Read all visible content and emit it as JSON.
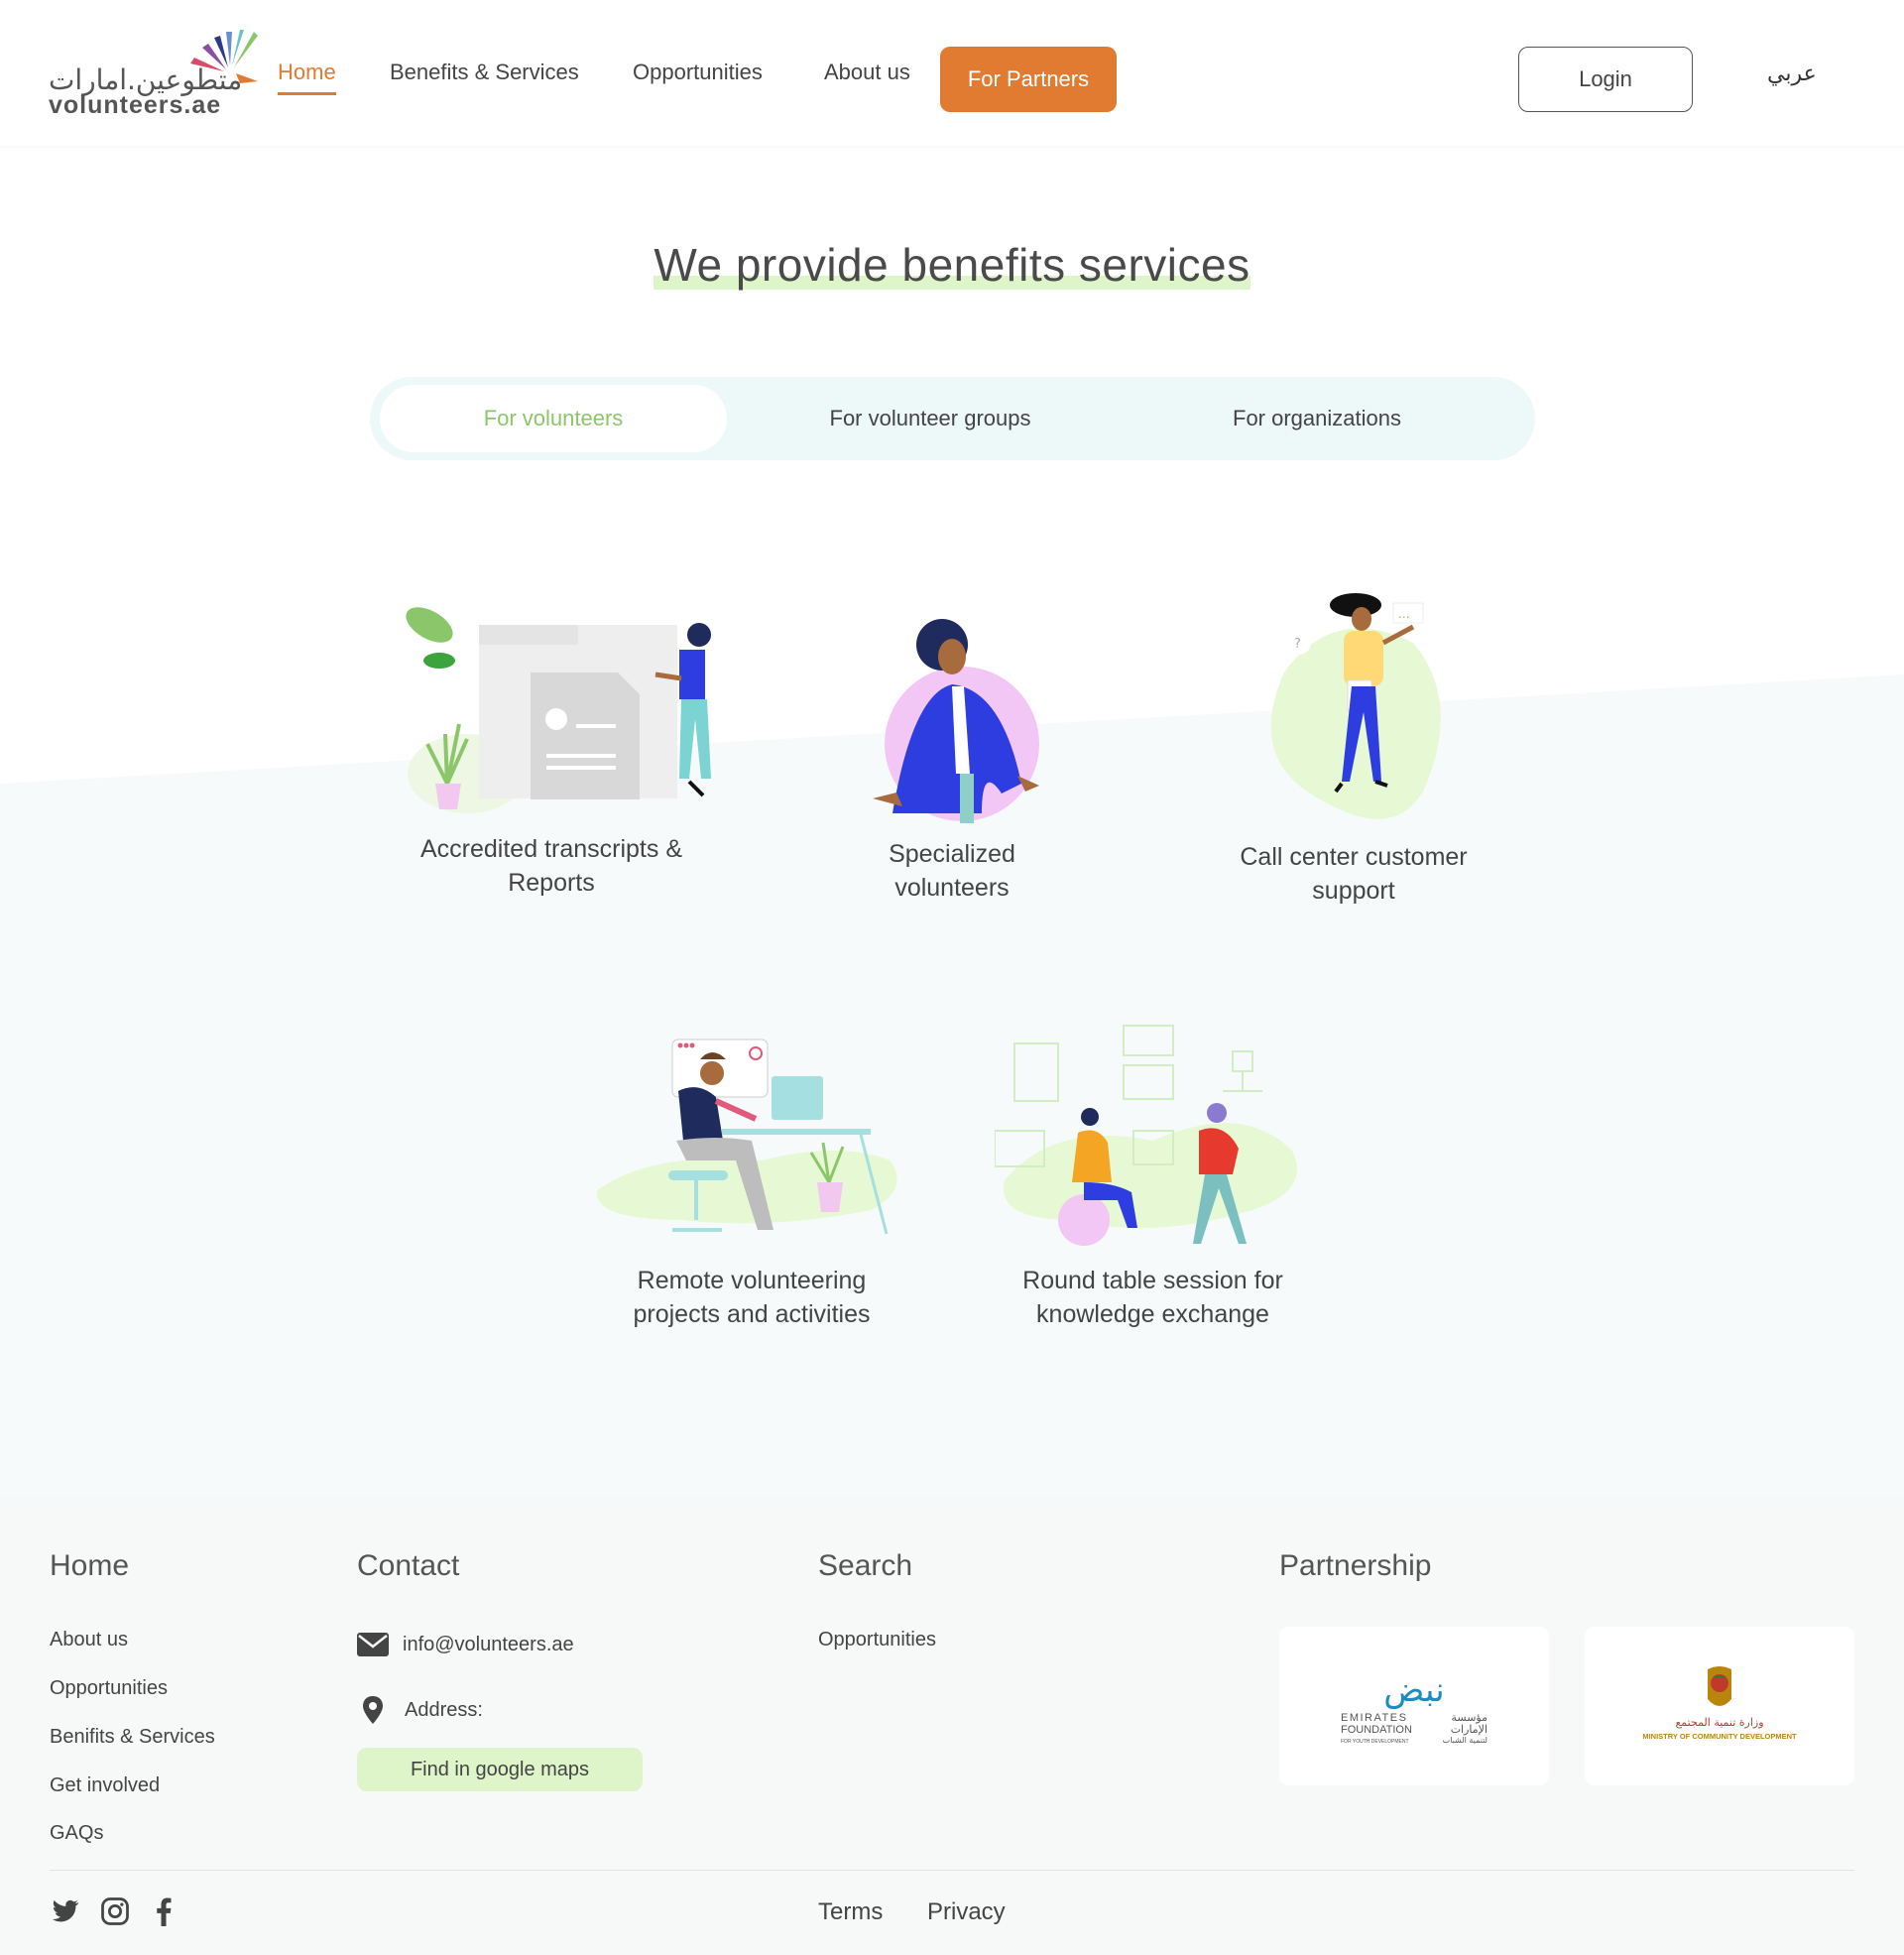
{
  "header": {
    "logo_ar": "متطوعين.امارات",
    "logo_en": "volunteers.ae",
    "nav": [
      "Home",
      "Benefits & Services",
      "Opportunities",
      "About us"
    ],
    "partners_label": "For Partners",
    "login_label": "Login",
    "lang_label": "عربي"
  },
  "main": {
    "headline": "We provide benefits services",
    "tabs": [
      "For volunteers",
      "For volunteer groups",
      "For organizations"
    ],
    "active_tab": "For volunteers",
    "cards": [
      {
        "label": "Accredited transcripts & Reports",
        "icon": "transcript-illustration"
      },
      {
        "label": "Specialized volunteers",
        "icon": "volunteer-illustration"
      },
      {
        "label": "Call center customer support",
        "icon": "call-center-illustration"
      },
      {
        "label": "Remote volunteering projects and activities",
        "icon": "remote-work-illustration"
      },
      {
        "label": "Round table session for knowledge exchange",
        "icon": "round-table-illustration"
      }
    ]
  },
  "footer": {
    "home": {
      "title": "Home",
      "links": [
        "About us",
        "Opportunities",
        "Benifits & Services",
        "Get involved",
        "GAQs"
      ]
    },
    "contact": {
      "title": "Contact",
      "email": "info@volunteers.ae",
      "address_label": "Address:",
      "maps_label": "Find in google maps"
    },
    "search": {
      "title": "Search",
      "links": [
        "Opportunities"
      ]
    },
    "partnership": {
      "title": "Partnership",
      "partners": [
        {
          "name_ar": "نبض",
          "line1": "EMIRATES",
          "line2": "FOUNDATION",
          "line3": "FOR YOUTH DEVELOPMENT",
          "line_ar1": "مؤسسة",
          "line_ar2": "الإمارات",
          "line_ar3": "لتنمية الشباب"
        },
        {
          "name_ar": "وزارة تنمية المجتمع",
          "name_en": "MINISTRY OF COMMUNITY DEVELOPMENT"
        }
      ]
    },
    "social": [
      "twitter-icon",
      "instagram-icon",
      "facebook-icon"
    ],
    "bottom_links": [
      "Terms",
      "Privacy"
    ]
  },
  "colors": {
    "accent": "#e07b31",
    "green": "#8cc66b",
    "highlight": "#ddf5c8",
    "tabs_bg": "#edf8f9",
    "blue": "#2d3de0"
  }
}
